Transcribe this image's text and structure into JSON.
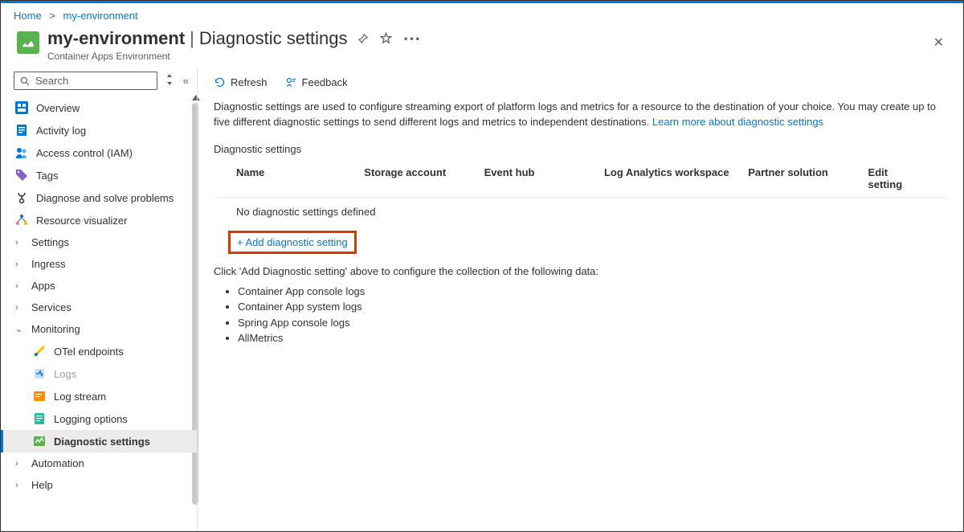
{
  "breadcrumb": {
    "home": "Home",
    "current": "my-environment"
  },
  "header": {
    "resource_name": "my-environment",
    "page_name": "Diagnostic settings",
    "subtitle": "Container Apps Environment"
  },
  "search": {
    "placeholder": "Search"
  },
  "nav": {
    "overview": "Overview",
    "activity": "Activity log",
    "iam": "Access control (IAM)",
    "tags": "Tags",
    "diagnose": "Diagnose and solve problems",
    "visualizer": "Resource visualizer",
    "settings": "Settings",
    "ingress": "Ingress",
    "apps": "Apps",
    "services": "Services",
    "monitoring": "Monitoring",
    "otel": "OTel endpoints",
    "logs": "Logs",
    "logstream": "Log stream",
    "logopts": "Logging options",
    "diagset": "Diagnostic settings",
    "automation": "Automation",
    "help": "Help"
  },
  "toolbar": {
    "refresh": "Refresh",
    "feedback": "Feedback"
  },
  "main": {
    "description": "Diagnostic settings are used to configure streaming export of platform logs and metrics for a resource to the destination of your choice. You may create up to five different diagnostic settings to send different logs and metrics to independent destinations. ",
    "learn_link": "Learn more about diagnostic settings",
    "section": "Diagnostic settings",
    "cols": {
      "name": "Name",
      "storage": "Storage account",
      "event": "Event hub",
      "log": "Log Analytics workspace",
      "partner": "Partner solution",
      "edit": "Edit setting"
    },
    "empty": "No diagnostic settings defined",
    "add": "+ Add diagnostic setting",
    "instr": "Click 'Add Diagnostic setting' above to configure the collection of the following data:",
    "items": [
      "Container App console logs",
      "Container App system logs",
      "Spring App console logs",
      "AllMetrics"
    ]
  }
}
